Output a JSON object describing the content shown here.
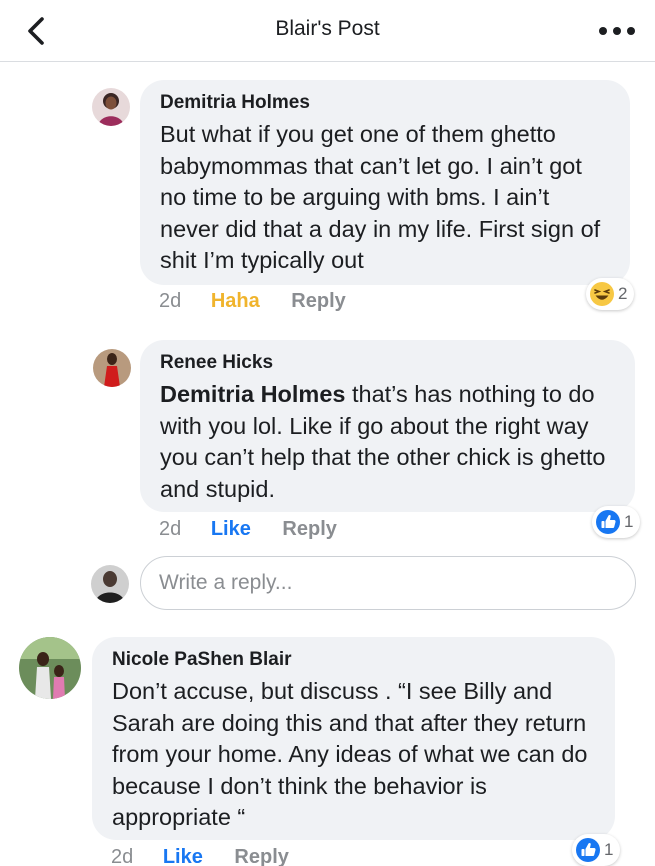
{
  "header": {
    "title": "Blair's Post",
    "back_icon": "chevron-left-icon",
    "more_icon": "more-dots-icon"
  },
  "comments": [
    {
      "author": "Demitria Holmes",
      "text": "But what if you get one of them ghetto babymommas that can’t let go. I ain’t got no time to be arguing with bms. I ain’t never did that a day in my life. First sign of shit I’m typically out",
      "time": "2d",
      "reaction_action": "Haha",
      "reply_label": "Reply",
      "reaction_icon": "haha-emoji-icon",
      "reaction_count": "2"
    },
    {
      "author": "Renee Hicks",
      "mention": "Demitria Holmes",
      "text": " that’s has nothing to do with you lol. Like if go about the right way you can’t help that the other chick is ghetto and stupid.",
      "time": "2d",
      "reaction_action": "Like",
      "reply_label": "Reply",
      "reaction_icon": "thumbs-up-icon",
      "reaction_count": "1"
    },
    {
      "author": "Nicole PaShen Blair",
      "text": "Don’t accuse, but discuss . “I see Billy and Sarah are doing this and that after they return from your home. Any ideas of what we can do because I don’t think the behavior is appropriate “",
      "time": "2d",
      "reaction_action": "Like",
      "reply_label": "Reply",
      "reaction_icon": "thumbs-up-icon",
      "reaction_count": "1"
    }
  ],
  "reply_box": {
    "placeholder": "Write a reply..."
  },
  "colors": {
    "bubble": "#f0f2f5",
    "like_blue": "#1877f2",
    "haha_yellow": "#f0b42d",
    "muted_text": "#8a8d91"
  }
}
